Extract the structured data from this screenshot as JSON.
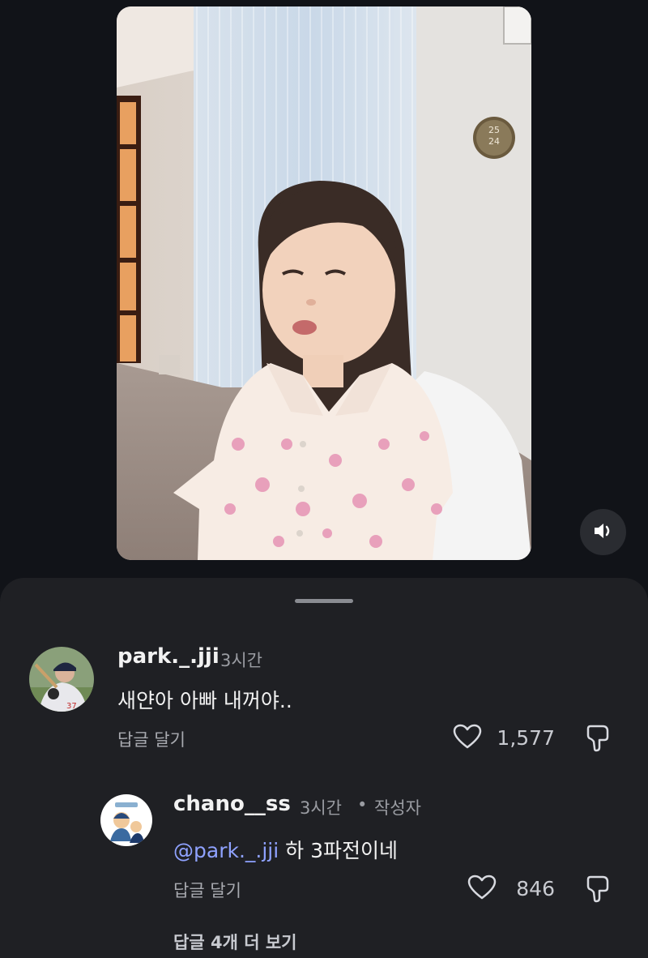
{
  "video": {
    "clock_top": "25",
    "clock_bottom": "24",
    "mute_icon": "volume-icon"
  },
  "comments": [
    {
      "username": "park._.jji",
      "time": "3시간",
      "text": "새얀아 아빠 내꺼야..",
      "reply_label": "답글 달기",
      "likes": "1,577"
    }
  ],
  "reply": {
    "username": "chano__ss",
    "time": "3시간",
    "badge": "작성자",
    "mention": "@park._.jji",
    "text": " 하 3파전이네",
    "reply_label": "답글 달기",
    "likes": "846"
  },
  "more_replies": "답글 4개 더 보기",
  "colors": {
    "background": "#111318",
    "sheet": "#1f2024",
    "mention": "#8fa2ff"
  }
}
